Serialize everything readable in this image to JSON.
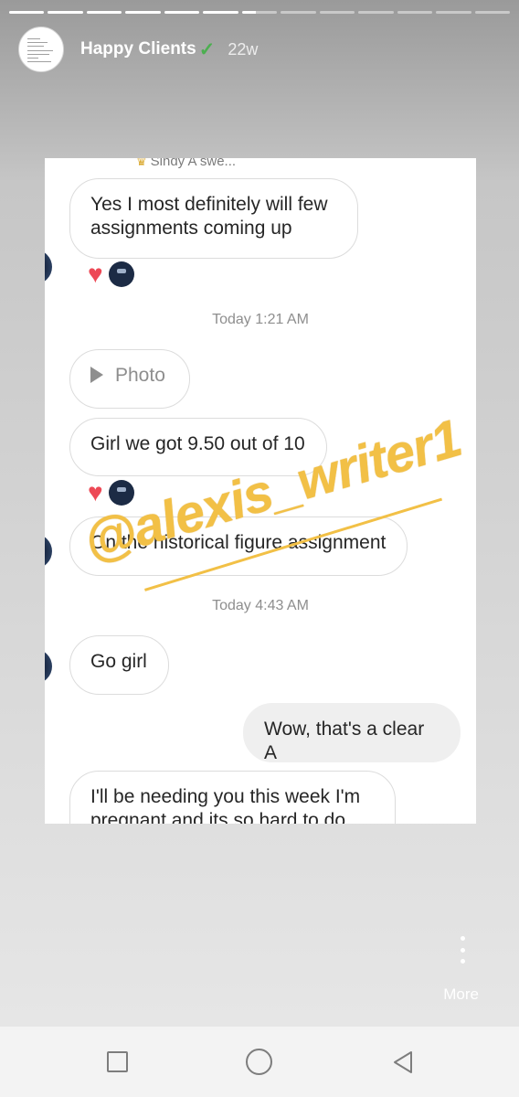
{
  "story": {
    "author": "Happy Clients",
    "verified_icon": "✓",
    "age": "22w",
    "more_label": "More"
  },
  "progress": {
    "total_segments": 13,
    "current_segment": 7
  },
  "conversation": {
    "contact_name_partial": "Sindy A swe...",
    "messages": [
      {
        "text": "Yes I most definitely will few assignments coming up"
      },
      {
        "text": "Today 1:21 AM"
      },
      {
        "text": "Photo"
      },
      {
        "text": "Girl we got 9.50 out of 10"
      },
      {
        "text": "On the historical figure assignment"
      },
      {
        "text": "Today 4:43 AM"
      },
      {
        "text": "Go girl"
      },
      {
        "text": "Wow, that's a clear A"
      },
      {
        "text": "I'll be needing you this week I'm pregnant and its so hard to do"
      }
    ]
  },
  "watermark": "@alexis_writer1",
  "colors": {
    "heart": "#ed4956",
    "watermark": "#f2c046",
    "verified": "#4caf50"
  }
}
